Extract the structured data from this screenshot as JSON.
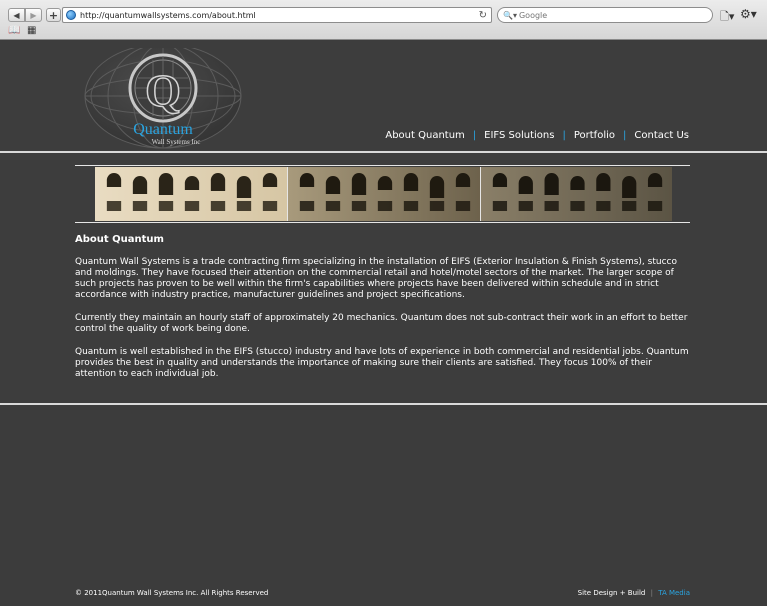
{
  "browser": {
    "url": "http://quantumwallsystems.com/about.html",
    "search_placeholder": "Google",
    "back_glyph": "◀",
    "forward_glyph": "▶",
    "new_tab_glyph": "+",
    "reload_glyph": "↻",
    "search_glyph": "🔍▾",
    "page_menu_glyph": "🗋▾",
    "gear_glyph": "⚙▾",
    "bookmarks_glyph": "📖",
    "grid_glyph": "▦"
  },
  "site": {
    "logo": {
      "letter": "Q",
      "name": "Quantum",
      "tagline": "Wall Systems Inc",
      "accent_color": "#2aa4e0"
    },
    "nav": {
      "items": [
        "About Quantum",
        "EIFS Solutions",
        "Portfolio",
        "Contact Us"
      ],
      "separator": "|"
    },
    "banner_image": "building-arches-photo"
  },
  "article": {
    "title": "About Quantum",
    "paragraphs": [
      "Quantum Wall Systems is a trade contracting firm specializing in the installation of EIFS (Exterior Insulation & Finish Systems), stucco and moldings. They have focused their attention on the commercial retail and hotel/motel sectors of the market. The larger scope of such projects has proven to be well within the firm's capabilities where projects have been delivered within schedule and in strict accordance with industry practice, manufacturer guidelines and project specifications.",
      "Currently they maintain an hourly staff of approximately 20 mechanics. Quantum does not sub-contract their work in an effort to better control the quality of work being done.",
      "Quantum is well established in the EIFS (stucco) industry and have lots of experience in both commercial and residential jobs. Quantum provides the best in quality and understands the importance of making sure their clients are satisfied. They focus 100% of their attention to each individual job."
    ]
  },
  "footer": {
    "copyright": "© 2011Quantum Wall Systems Inc. All Rights Reserved",
    "credit_label": "Site Design + Build",
    "credit_divider": "|",
    "credit_link": "TA Media"
  }
}
